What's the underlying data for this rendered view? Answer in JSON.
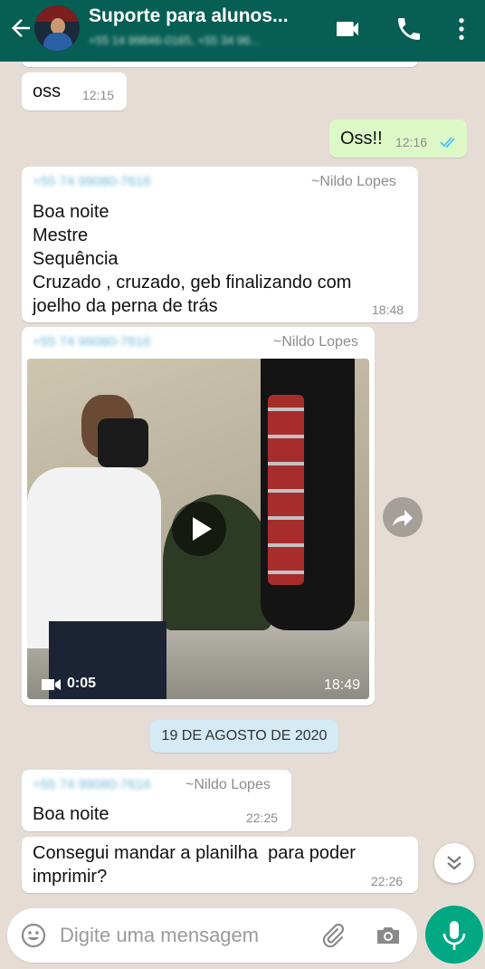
{
  "header": {
    "title": "Suporte para alunos...",
    "subtitle": "+55 14 99846-0165, +55 34 96...",
    "back_icon": "arrow-left-icon",
    "video_call_icon": "video-camera-icon",
    "voice_call_icon": "phone-icon",
    "menu_icon": "more-vertical-icon",
    "colors": {
      "bar": "#075e54"
    }
  },
  "messages": {
    "m1": {
      "text": "oss",
      "time": "12:15"
    },
    "m2": {
      "text": "Oss!!",
      "time": "12:16",
      "status": "read"
    },
    "m3": {
      "phone": "+55 74 99080-7616",
      "name": "~Nildo Lopes",
      "text": "Boa noite\nMestre\nSequência\nCruzado , cruzado, geb finalizando com\njoelho da perna de trás",
      "time": "18:48"
    },
    "m4": {
      "phone": "+55 74 99080-7616",
      "name": "~Nildo Lopes",
      "video_duration": "0:05",
      "time": "18:49"
    },
    "date_separator": "19 DE AGOSTO DE 2020",
    "m5": {
      "phone": "+55 74 99080-7616",
      "name": "~Nildo Lopes",
      "text": "Boa noite",
      "time": "22:25"
    },
    "m6": {
      "text": "Consegui mandar a planilha  para poder\nimprimir?",
      "time": "22:26"
    }
  },
  "composer": {
    "placeholder": "Digite uma mensagem",
    "emoji_icon": "emoji-icon",
    "attach_icon": "paperclip-icon",
    "camera_icon": "camera-icon",
    "mic_icon": "microphone-icon"
  },
  "colors": {
    "chat_bg": "#e5ddd5",
    "outgoing": "#dcf8c6",
    "accent": "#00a884",
    "read_ticks": "#4fc3f7"
  }
}
